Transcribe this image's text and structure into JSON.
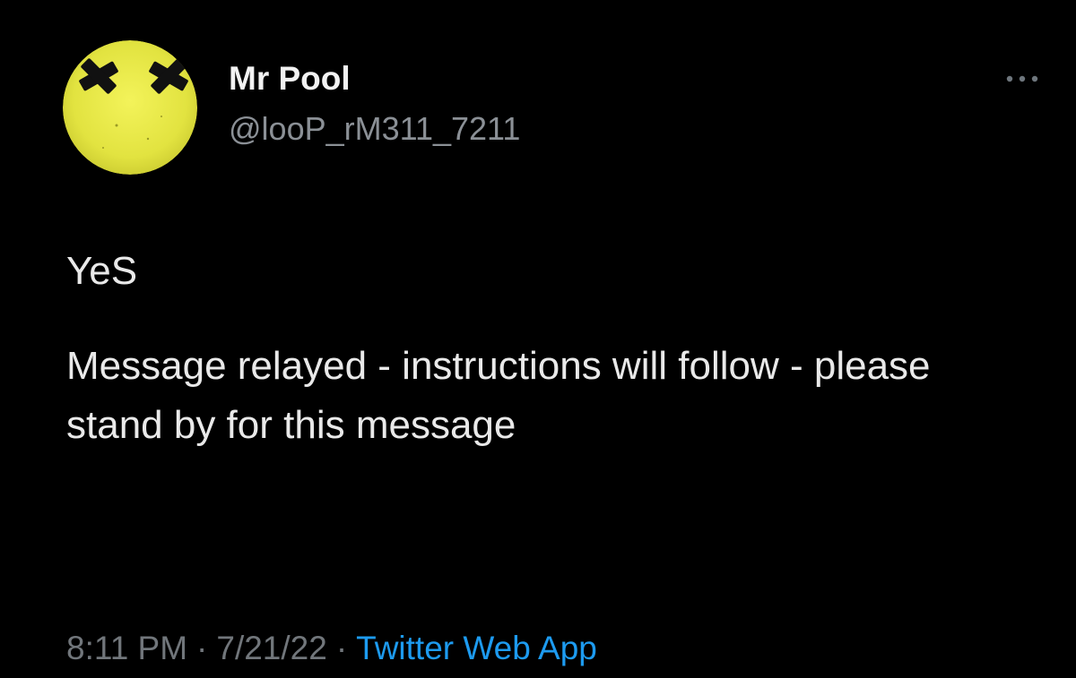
{
  "tweet": {
    "author": {
      "display_name": "Mr Pool",
      "handle": "@looP_rM311_7211",
      "avatar_icon": "yellow-face-x-eyes-avatar"
    },
    "more_icon": "more-options-icon",
    "text": {
      "line1": "YeS",
      "line2": "Message relayed - instructions will follow - please stand by for this message"
    },
    "meta": {
      "time": "8:11 PM",
      "separator": "·",
      "date": "7/21/22",
      "source": "Twitter Web App"
    }
  },
  "colors": {
    "background": "#000000",
    "text_primary": "#e7e9ea",
    "text_secondary": "#71767b",
    "link_blue": "#1d9bf0",
    "avatar_yellow": "#e6e64a"
  }
}
